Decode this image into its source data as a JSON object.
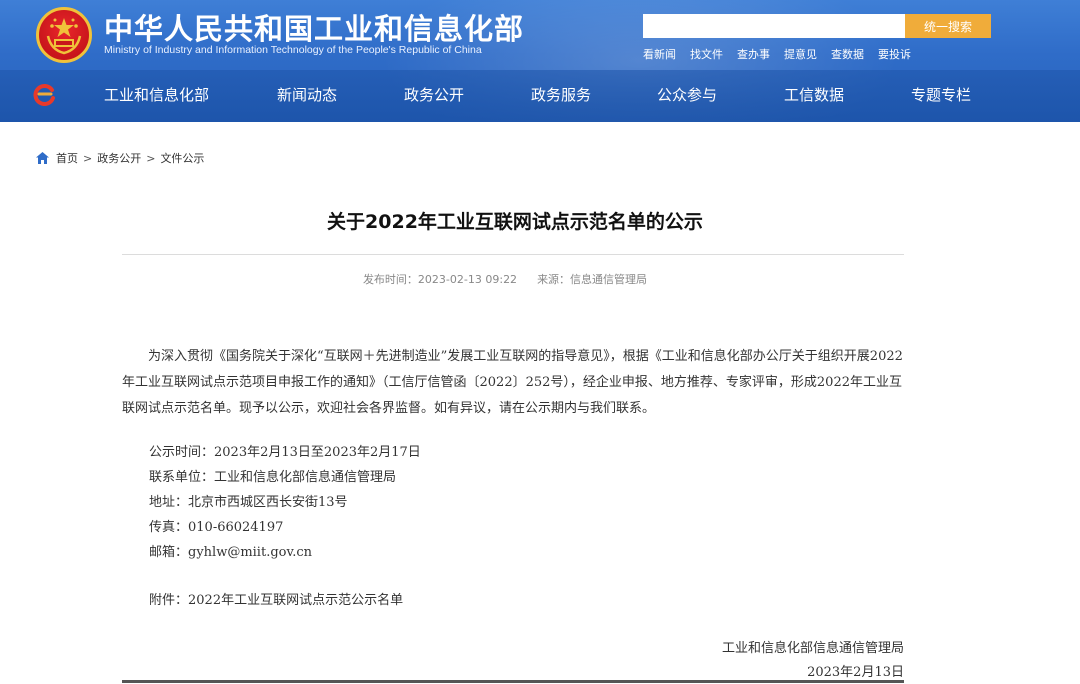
{
  "header": {
    "site_title_cn": "中华人民共和国工业和信息化部",
    "site_title_en": "Ministry of Industry and Information Technology of the People's Republic of China",
    "search": {
      "placeholder": "",
      "button_label": "统一搜索"
    },
    "quick_links": [
      "看新闻",
      "找文件",
      "查办事",
      "提意见",
      "查数据",
      "要投诉"
    ],
    "nav": [
      "工业和信息化部",
      "新闻动态",
      "政务公开",
      "政务服务",
      "公众参与",
      "工信数据",
      "专题专栏"
    ]
  },
  "breadcrumb": [
    "首页",
    "政务公开",
    "文件公示"
  ],
  "article": {
    "title": "关于2022年工业互联网试点示范名单的公示",
    "publish_time": "发布时间：2023-02-13 09:22",
    "source": "来源：信息通信管理局",
    "body": "为深入贯彻《国务院关于深化“互联网＋先进制造业”发展工业互联网的指导意见》，根据《工业和信息化部办公厅关于组织开展2022年工业互联网试点示范项目申报工作的通知》（工信厅信管函〔2022〕252号），经企业申报、地方推荐、专家评审，形成2022年工业互联网试点示范名单。现予以公示，欢迎社会各界监督。如有异议，请在公示期内与我们联系。",
    "info": [
      "公示时间：2023年2月13日至2023年2月17日",
      "联系单位：工业和信息化部信息通信管理局",
      "地址：北京市西城区西长安街13号",
      "传真：010-66024197",
      "邮箱：gyhlw@miit.gov.cn"
    ],
    "attachment": "附件：2022年工业互联网试点示范公示名单",
    "signature_org": "工业和信息化部信息通信管理局",
    "signature_date": "2023年2月13日"
  },
  "colors": {
    "header_blue": "#2f6cc8",
    "search_button": "#f0ac3a",
    "emblem_red": "#c8151b",
    "emblem_gold": "#f0c23a"
  },
  "icons": [
    "national-emblem-icon",
    "site-logo-icon",
    "home-icon"
  ]
}
